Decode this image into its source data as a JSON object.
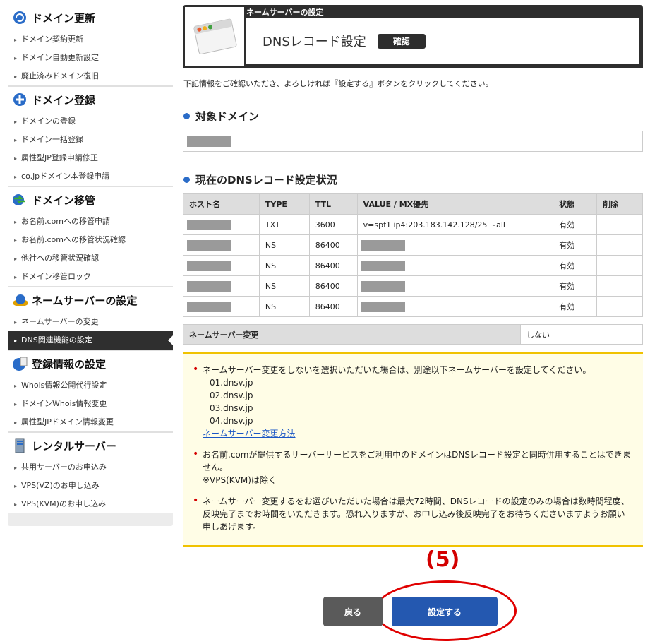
{
  "sidebar": {
    "sections": [
      {
        "title": "ドメイン更新",
        "icon": "refresh-globe-icon",
        "items": [
          "ドメイン契約更新",
          "ドメイン自動更新設定",
          "廃止済みドメイン復旧"
        ]
      },
      {
        "title": "ドメイン登録",
        "icon": "plus-circle-icon",
        "items": [
          "ドメインの登録",
          "ドメイン一括登録",
          "属性型JP登録申請修正",
          "co.jpドメイン本登録申請"
        ]
      },
      {
        "title": "ドメイン移管",
        "icon": "transfer-globe-icon",
        "items": [
          "お名前.comへの移管申請",
          "お名前.comへの移管状況確認",
          "他社への移管状況確認",
          "ドメイン移管ロック"
        ]
      },
      {
        "title": "ネームサーバーの設定",
        "icon": "server-globe-icon",
        "items": [
          "ネームサーバーの変更",
          "DNS関連機能の設定"
        ]
      },
      {
        "title": "登録情報の設定",
        "icon": "registration-globe-icon",
        "items": [
          "Whois情報公開代行設定",
          "ドメインWhois情報変更",
          "属性型JPドメイン情報変更"
        ]
      },
      {
        "title": "レンタルサーバー",
        "icon": "server-tower-icon",
        "items": [
          "共用サーバーのお申込み",
          "VPS(VZ)のお申し込み",
          "VPS(KVM)のお申し込み"
        ]
      }
    ]
  },
  "header": {
    "category": "ネームサーバーの設定",
    "title": "DNSレコード設定",
    "badge": "確認"
  },
  "intro": "下記情報をご確認いただき、よろしければ『設定する』ボタンをクリックしてください。",
  "target_domain": {
    "heading": "対象ドメイン"
  },
  "dns_status": {
    "heading": "現在のDNSレコード設定状況",
    "columns": [
      "ホスト名",
      "TYPE",
      "TTL",
      "VALUE / MX優先",
      "状態",
      "削除"
    ],
    "rows": [
      {
        "type": "TXT",
        "ttl": "3600",
        "value": "v=spf1 ip4:203.183.142.128/25 ~all",
        "status": "有効"
      },
      {
        "type": "NS",
        "ttl": "86400",
        "value": "",
        "status": "有効"
      },
      {
        "type": "NS",
        "ttl": "86400",
        "value": "",
        "status": "有効"
      },
      {
        "type": "NS",
        "ttl": "86400",
        "value": "",
        "status": "有効"
      },
      {
        "type": "NS",
        "ttl": "86400",
        "value": "",
        "status": "有効"
      }
    ]
  },
  "ns_change": {
    "label": "ネームサーバー変更",
    "value": "しない"
  },
  "notice": {
    "note1": "ネームサーバー変更をしないを選択いただいた場合は、別途以下ネームサーバーを設定してください。",
    "ns_list": [
      "01.dnsv.jp",
      "02.dnsv.jp",
      "03.dnsv.jp",
      "04.dnsv.jp"
    ],
    "link": "ネームサーバー変更方法",
    "note2": "お名前.comが提供するサーバーサービスをご利用中のドメインはDNSレコード設定と同時併用することはできません。",
    "note2b": "※VPS(KVM)は除く",
    "note3": "ネームサーバー変更するをお選びいただいた場合は最大72時間、DNSレコードの設定のみの場合は数時間程度、反映完了までお時間をいただきます。恐れ入りますが、お申し込み後反映完了をお待ちくださいますようお願い申しあげます。"
  },
  "annotation": {
    "step": "(5)"
  },
  "buttons": {
    "back": "戻る",
    "submit": "設定する"
  },
  "colors": {
    "accent": "#2458b0",
    "highlight": "#e00000",
    "notice_bg": "#fffde6"
  }
}
